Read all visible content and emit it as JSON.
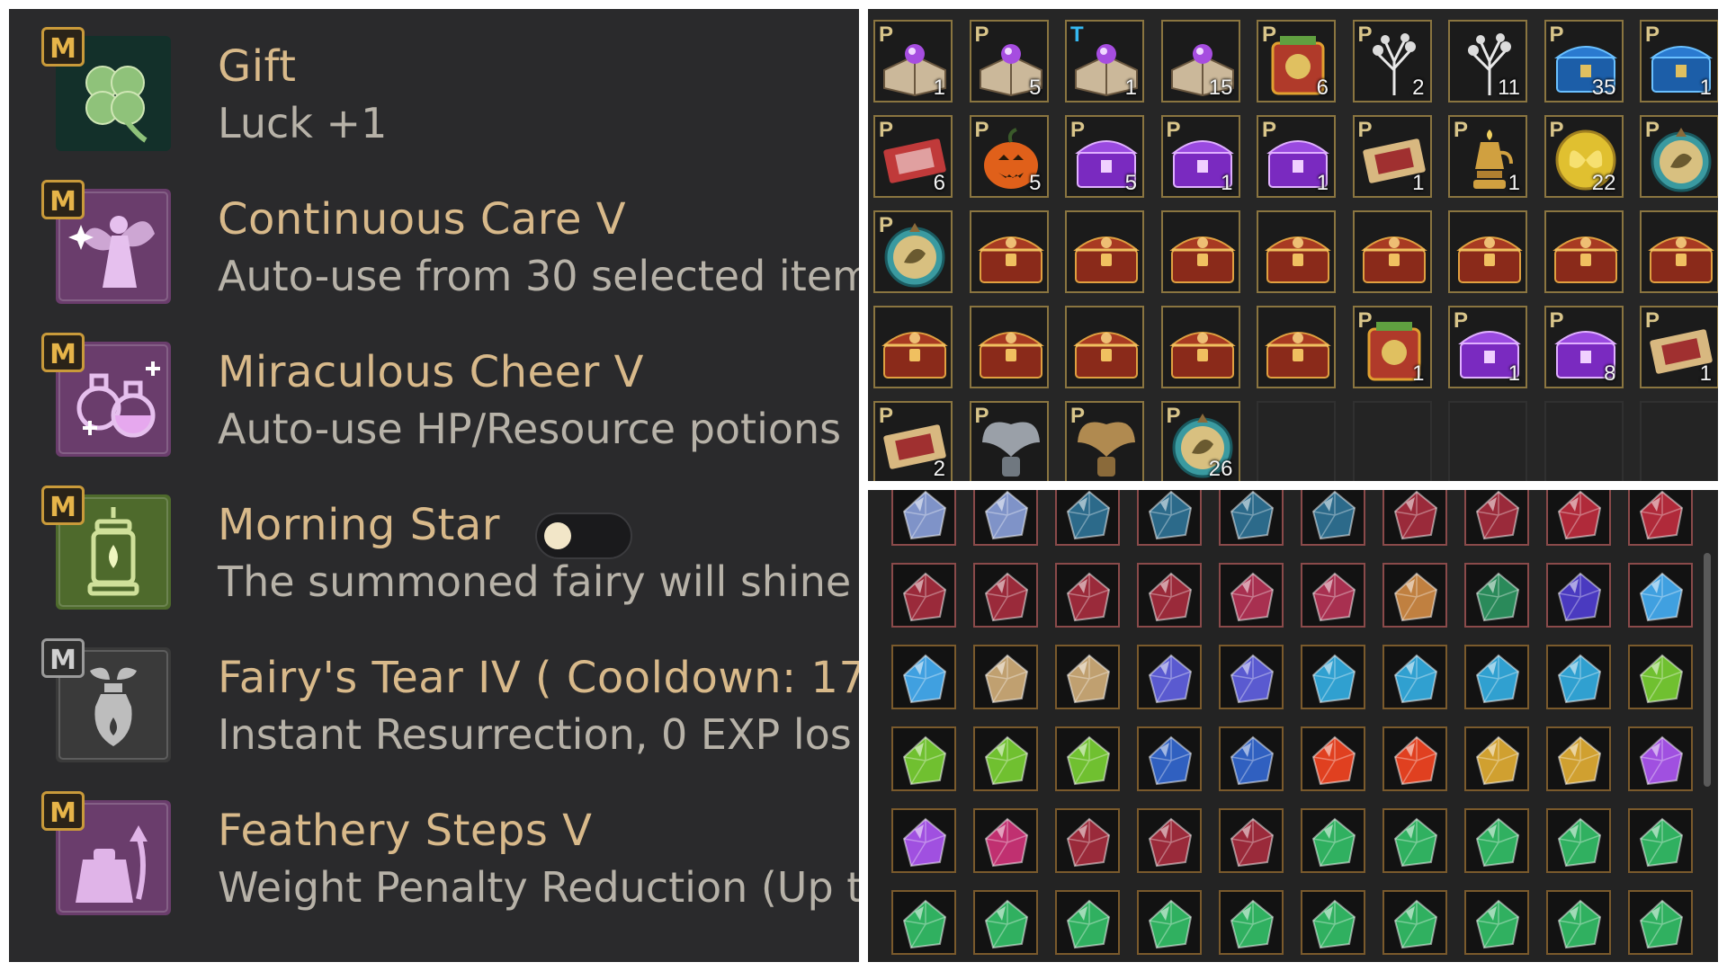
{
  "skills": [
    {
      "badge": "M",
      "badge_style": "gold",
      "icon": "clover-icon",
      "icon_color": "#3d6b3a",
      "name": "Gift",
      "desc": "Luck +1"
    },
    {
      "badge": "M",
      "badge_style": "gold",
      "icon": "fairy-icon",
      "icon_color": "#6a3d6c",
      "name": "Continuous Care V",
      "desc": "Auto-use from 30 selected item"
    },
    {
      "badge": "M",
      "badge_style": "gold",
      "icon": "potions-icon",
      "icon_color": "#6a3d6c",
      "name": "Miraculous Cheer V",
      "desc": "Auto-use HP/Resource potions"
    },
    {
      "badge": "M",
      "badge_style": "gold",
      "icon": "lantern-icon",
      "icon_color": "#4e6a2c",
      "name": "Morning Star",
      "desc": "The summoned fairy will shine",
      "toggle": "off"
    },
    {
      "badge": "M",
      "badge_style": "grey",
      "icon": "tear-bottle-icon",
      "icon_color": "#3a3a3a",
      "name": "Fairy's Tear IV  ( Cooldown: 17",
      "desc": "Instant Resurrection, 0 EXP los"
    },
    {
      "badge": "M",
      "badge_style": "gold",
      "icon": "weight-icon",
      "icon_color": "#6a3d6c",
      "name": "Feathery Steps V",
      "desc": "Weight Penalty Reduction (Up t"
    }
  ],
  "inventory": {
    "rows": [
      [
        {
          "flag": "P",
          "icon": "spellbook-icon",
          "count": "1"
        },
        {
          "flag": "P",
          "icon": "spellbook-icon",
          "count": "5"
        },
        {
          "flag": "T",
          "icon": "spellbook-icon",
          "count": "1"
        },
        {
          "flag": "",
          "icon": "spellbook-icon",
          "count": "15"
        },
        {
          "flag": "P",
          "icon": "red-crate-icon",
          "count": "6"
        },
        {
          "flag": "P",
          "icon": "white-tree-icon",
          "count": "2"
        },
        {
          "flag": "",
          "icon": "white-tree-icon",
          "count": "11"
        },
        {
          "flag": "P",
          "icon": "blue-chest-icon",
          "count": "35"
        },
        {
          "flag": "P",
          "icon": "blue-chest-icon",
          "count": "1"
        }
      ],
      [
        {
          "flag": "P",
          "icon": "ticket-red-icon",
          "count": "6"
        },
        {
          "flag": "P",
          "icon": "pumpkin-icon",
          "count": "5"
        },
        {
          "flag": "P",
          "icon": "purple-chest-icon",
          "count": "5"
        },
        {
          "flag": "P",
          "icon": "purple-chest-icon",
          "count": "1"
        },
        {
          "flag": "P",
          "icon": "purple-chest-icon",
          "count": "1"
        },
        {
          "flag": "P",
          "icon": "ticket-icon",
          "count": "1"
        },
        {
          "flag": "P",
          "icon": "golden-lamp-icon",
          "count": "1"
        },
        {
          "flag": "P",
          "icon": "butterfly-coin-icon",
          "count": "22"
        },
        {
          "flag": "P",
          "icon": "medallion-icon",
          "count": ""
        }
      ],
      [
        {
          "flag": "P",
          "icon": "medallion-icon",
          "count": ""
        },
        {
          "flag": "",
          "icon": "treasure-chest-icon",
          "count": ""
        },
        {
          "flag": "",
          "icon": "treasure-chest-icon",
          "count": ""
        },
        {
          "flag": "",
          "icon": "treasure-chest-icon",
          "count": ""
        },
        {
          "flag": "",
          "icon": "treasure-chest-icon",
          "count": ""
        },
        {
          "flag": "",
          "icon": "treasure-chest-icon",
          "count": ""
        },
        {
          "flag": "",
          "icon": "treasure-chest-icon",
          "count": ""
        },
        {
          "flag": "",
          "icon": "treasure-chest-icon",
          "count": ""
        },
        {
          "flag": "",
          "icon": "treasure-chest-icon",
          "count": ""
        }
      ],
      [
        {
          "flag": "",
          "icon": "treasure-chest-icon",
          "count": ""
        },
        {
          "flag": "",
          "icon": "treasure-chest-icon",
          "count": ""
        },
        {
          "flag": "",
          "icon": "treasure-chest-icon",
          "count": ""
        },
        {
          "flag": "",
          "icon": "treasure-chest-icon",
          "count": ""
        },
        {
          "flag": "",
          "icon": "treasure-chest-icon",
          "count": ""
        },
        {
          "flag": "P",
          "icon": "red-crate-icon",
          "count": "1"
        },
        {
          "flag": "P",
          "icon": "purple-chest-icon",
          "count": "1"
        },
        {
          "flag": "P",
          "icon": "purple-chest-icon",
          "count": "8"
        },
        {
          "flag": "P",
          "icon": "ticket-icon",
          "count": "1"
        }
      ],
      [
        {
          "flag": "P",
          "icon": "ticket-icon",
          "count": "2"
        },
        {
          "flag": "P",
          "icon": "silver-wing-emblem-icon",
          "count": ""
        },
        {
          "flag": "P",
          "icon": "bronze-wing-emblem-icon",
          "count": ""
        },
        {
          "flag": "P",
          "icon": "medallion-icon",
          "count": "26"
        },
        {
          "empty": true
        },
        {
          "empty": true
        },
        {
          "empty": true
        },
        {
          "empty": true
        },
        {
          "empty": true
        }
      ]
    ]
  },
  "gems": {
    "rows": [
      [
        "#7f93c8",
        "#7f93c8",
        "#2c6a8a",
        "#2c6a8a",
        "#2c6a8a",
        "#2c6a8a",
        "#9a2a3a",
        "#9a2a3a",
        "#b02a3a",
        "#b02a3a"
      ],
      [
        "#9a2a3a",
        "#9a2a3a",
        "#9a2a3a",
        "#9a2a3a",
        "#a83050",
        "#a83050",
        "#c08040",
        "#2a8a5a",
        "#4a3ac0",
        "#40a0e0"
      ],
      [
        "#40a0e0",
        "#c0a070",
        "#c0a070",
        "#5a5ad0",
        "#5a5ad0",
        "#30a0d0",
        "#30a0d0",
        "#30a0d0",
        "#30a0d0",
        "#70c030"
      ],
      [
        "#70c030",
        "#70c030",
        "#70c030",
        "#3060c0",
        "#3060c0",
        "#e04020",
        "#e04020",
        "#d0a030",
        "#d0a030",
        "#a050e0"
      ],
      [
        "#a050e0",
        "#c03070",
        "#9a2a3a",
        "#9a2a3a",
        "#9a2a3a",
        "#30b060",
        "#30b060",
        "#30b060",
        "#30b060",
        "#30b060"
      ],
      [
        "#30b060",
        "#30b060",
        "#30b060",
        "#30b060",
        "#30b060",
        "#30b060",
        "#30b060",
        "#30b060",
        "#30b060",
        "#30b060"
      ]
    ]
  }
}
